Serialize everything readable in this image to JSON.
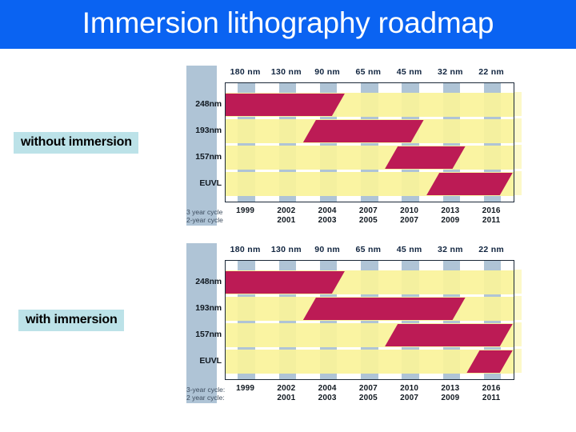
{
  "slide": {
    "title": "Immersion lithography roadmap",
    "title_bg": "#0A63F2",
    "title_color": "#FFFFFF",
    "background": "#FFFFFF"
  },
  "captions": {
    "without": "without immersion",
    "with": "with immersion",
    "bg": "#BCE2E8"
  },
  "colors": {
    "bar": "#BC1B55",
    "stripe": "#AFC4D6",
    "rowband": "#FAF39A",
    "frame": "#1B2838"
  },
  "chart_data": [
    {
      "type": "bar",
      "name": "without-immersion",
      "title": "without immersion",
      "xlabel": "",
      "ylabel": "",
      "grid": false,
      "legend": "none",
      "categories": [
        "180 nm",
        "130 nm",
        "90 nm",
        "65 nm",
        "45 nm",
        "32 nm",
        "22 nm"
      ],
      "rows": [
        "248nm",
        "193nm",
        "157nm",
        "EUVL"
      ],
      "axis_captions": {
        "three_year": "3 year cycle",
        "two_year": "2-year cycle"
      },
      "years_three_year": [
        "1999",
        "2002",
        "2004",
        "2007",
        "2010",
        "2013",
        "2016"
      ],
      "years_two_year": [
        "",
        "2001",
        "2003",
        "2005",
        "2007",
        "2009",
        "2011"
      ],
      "series": [
        {
          "name": "248nm",
          "start_node": "180 nm",
          "end_node": "90 nm",
          "row": 0,
          "start_pct": 0.0,
          "end_pct": 41.5
        },
        {
          "name": "193nm",
          "start_node": "90 nm",
          "end_node": "45 nm",
          "row": 1,
          "start_pct": 27.0,
          "end_pct": 69.0
        },
        {
          "name": "157nm",
          "start_node": "45 nm",
          "end_node": "32 nm",
          "row": 2,
          "start_pct": 55.5,
          "end_pct": 83.5
        },
        {
          "name": "EUVL",
          "start_node": "32 nm",
          "end_node": "22 nm",
          "row": 3,
          "start_pct": 70.0,
          "end_pct": 100.0
        }
      ]
    },
    {
      "type": "bar",
      "name": "with-immersion",
      "title": "with immersion",
      "xlabel": "",
      "ylabel": "",
      "grid": false,
      "legend": "none",
      "categories": [
        "180 nm",
        "130 nm",
        "90 nm",
        "65 nm",
        "45 nm",
        "32 nm",
        "22 nm"
      ],
      "rows": [
        "248nm",
        "193nm",
        "157nm",
        "EUVL"
      ],
      "axis_captions": {
        "three_year": "3-year cycle:",
        "two_year": "2 year cycle:"
      },
      "years_three_year": [
        "1999",
        "2002",
        "2004",
        "2007",
        "2010",
        "2013",
        "2016"
      ],
      "years_two_year": [
        "",
        "2001",
        "2003",
        "2005",
        "2007",
        "2009",
        "2011"
      ],
      "series": [
        {
          "name": "248nm",
          "start_node": "180 nm",
          "end_node": "90 nm",
          "row": 0,
          "start_pct": 0.0,
          "end_pct": 41.5
        },
        {
          "name": "193nm",
          "start_node": "90 nm",
          "end_node": "32 nm",
          "row": 1,
          "start_pct": 27.0,
          "end_pct": 83.5
        },
        {
          "name": "157nm",
          "start_node": "65 nm",
          "end_node": "22 nm",
          "row": 2,
          "start_pct": 55.5,
          "end_pct": 100.0
        },
        {
          "name": "EUVL",
          "start_node": "22 nm",
          "end_node": "22 nm",
          "row": 3,
          "start_pct": 84.0,
          "end_pct": 100.0
        }
      ]
    }
  ]
}
